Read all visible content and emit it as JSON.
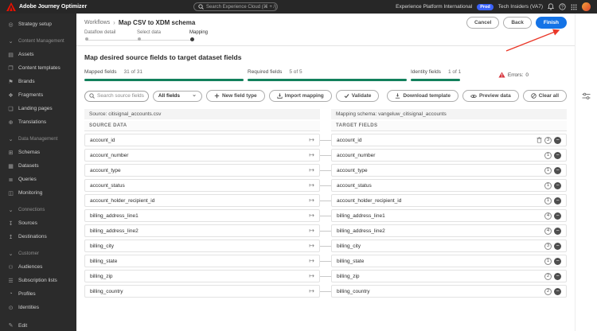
{
  "colors": {
    "accent_blue": "#1473e6",
    "progress_green": "#12805c",
    "error_red": "#d7373f",
    "env_badge_blue": "#3b63fb"
  },
  "topbar": {
    "app_name": "Adobe Journey Optimizer",
    "search_placeholder": "Search Experience Cloud (⌘ + /)",
    "org_name": "Experience Platform International",
    "env_badge": "Prod",
    "tenant": "Tech Insiders (VA7)"
  },
  "sidebar": {
    "items": [
      {
        "label": "Strategy setup",
        "type": "item",
        "name": "sidebar-item-strategy-setup",
        "icon": "strategy-setup-icon",
        "glyph": "◎"
      },
      {
        "label": "Content Management",
        "type": "section",
        "name": "sidebar-section-content-management",
        "icon": "chevron-down-icon",
        "glyph": "⌄"
      },
      {
        "label": "Assets",
        "type": "item",
        "name": "sidebar-item-assets",
        "icon": "assets-icon",
        "glyph": "▤"
      },
      {
        "label": "Content templates",
        "type": "item",
        "name": "sidebar-item-content-templates",
        "icon": "content-templates-icon",
        "glyph": "❐"
      },
      {
        "label": "Brands",
        "type": "item",
        "name": "sidebar-item-brands",
        "icon": "brands-icon",
        "glyph": "⚑"
      },
      {
        "label": "Fragments",
        "type": "item",
        "name": "sidebar-item-fragments",
        "icon": "fragments-icon",
        "glyph": "❖"
      },
      {
        "label": "Landing pages",
        "type": "item",
        "name": "sidebar-item-landing-pages",
        "icon": "landing-pages-icon",
        "glyph": "❏"
      },
      {
        "label": "Translations",
        "type": "item",
        "name": "sidebar-item-translations",
        "icon": "translations-icon",
        "glyph": "⊕"
      },
      {
        "label": "Data Management",
        "type": "section",
        "name": "sidebar-section-data-management",
        "icon": "chevron-down-icon",
        "glyph": "⌄"
      },
      {
        "label": "Schemas",
        "type": "item",
        "name": "sidebar-item-schemas",
        "icon": "schemas-icon",
        "glyph": "⊞"
      },
      {
        "label": "Datasets",
        "type": "item",
        "name": "sidebar-item-datasets",
        "icon": "datasets-icon",
        "glyph": "▦"
      },
      {
        "label": "Queries",
        "type": "item",
        "name": "sidebar-item-queries",
        "icon": "queries-icon",
        "glyph": "≣"
      },
      {
        "label": "Monitoring",
        "type": "item",
        "name": "sidebar-item-monitoring",
        "icon": "monitoring-icon",
        "glyph": "◫"
      },
      {
        "label": "Connections",
        "type": "section",
        "name": "sidebar-section-connections",
        "icon": "chevron-down-icon",
        "glyph": "⌄"
      },
      {
        "label": "Sources",
        "type": "item",
        "name": "sidebar-item-sources",
        "icon": "sources-icon",
        "glyph": "↧"
      },
      {
        "label": "Destinations",
        "type": "item",
        "name": "sidebar-item-destinations",
        "icon": "destinations-icon",
        "glyph": "↥"
      },
      {
        "label": "Customer",
        "type": "section",
        "name": "sidebar-section-customer",
        "icon": "chevron-down-icon",
        "glyph": "⌄"
      },
      {
        "label": "Audiences",
        "type": "item",
        "name": "sidebar-item-audiences",
        "icon": "audiences-icon",
        "glyph": "⚇"
      },
      {
        "label": "Subscription lists",
        "type": "item",
        "name": "sidebar-item-subscription-lists",
        "icon": "subscription-lists-icon",
        "glyph": "☰"
      },
      {
        "label": "Profiles",
        "type": "item",
        "name": "sidebar-item-profiles",
        "icon": "profiles-icon",
        "glyph": "◔"
      },
      {
        "label": "Identities",
        "type": "item",
        "name": "sidebar-item-identities",
        "icon": "identities-icon",
        "glyph": "⊙"
      }
    ],
    "footer_label": "Edit"
  },
  "header": {
    "breadcrumb_root": "Workflows",
    "breadcrumb_current": "Map CSV to XDM schema",
    "cancel_label": "Cancel",
    "back_label": "Back",
    "finish_label": "Finish"
  },
  "stepper": {
    "steps": [
      {
        "label": "Dataflow detail",
        "state": "done"
      },
      {
        "label": "Select data",
        "state": "done"
      },
      {
        "label": "Mapping",
        "state": "active"
      }
    ]
  },
  "mapping": {
    "title": "Map desired source fields to target dataset fields",
    "stats": [
      {
        "label": "Mapped fields",
        "value": "31 of 31",
        "size": "wide"
      },
      {
        "label": "Required fields",
        "value": "5 of 5",
        "size": "wide"
      },
      {
        "label": "Identity fields",
        "value": "1 of 1",
        "size": "narrow"
      }
    ],
    "errors_label": "Errors:",
    "errors_count": "0",
    "toolbar": {
      "search_placeholder": "Search source fields",
      "filter_value": "All fields",
      "new_field_type_label": "New field type",
      "import_mapping_label": "Import mapping",
      "validate_label": "Validate",
      "download_template_label": "Download template",
      "preview_data_label": "Preview data",
      "clear_all_label": "Clear all"
    },
    "source_label": "Source: citisignal_accounts.csv",
    "schema_label": "Mapping schema: vangeluw_citisignal_accounts",
    "columns": {
      "source": "SOURCE DATA",
      "target": "TARGET FIELDS"
    },
    "rows": [
      {
        "source": "account_id",
        "target": "account_id",
        "badge": "3",
        "trash": true
      },
      {
        "source": "account_number",
        "target": "account_number",
        "badge": "1"
      },
      {
        "source": "account_type",
        "target": "account_type",
        "badge": "1"
      },
      {
        "source": "account_status",
        "target": "account_status",
        "badge": "1"
      },
      {
        "source": "account_holder_recipient_id",
        "target": "account_holder_recipient_id",
        "badge": "1"
      },
      {
        "source": "billing_address_line1",
        "target": "billing_address_line1",
        "badge": "4"
      },
      {
        "source": "billing_address_line2",
        "target": "billing_address_line2",
        "badge": "4"
      },
      {
        "source": "billing_city",
        "target": "billing_city",
        "badge": "3"
      },
      {
        "source": "billing_state",
        "target": "billing_state",
        "badge": "1"
      },
      {
        "source": "billing_zip",
        "target": "billing_zip",
        "badge": "2"
      },
      {
        "source": "billing_country",
        "target": "billing_country",
        "badge": "2"
      }
    ]
  }
}
